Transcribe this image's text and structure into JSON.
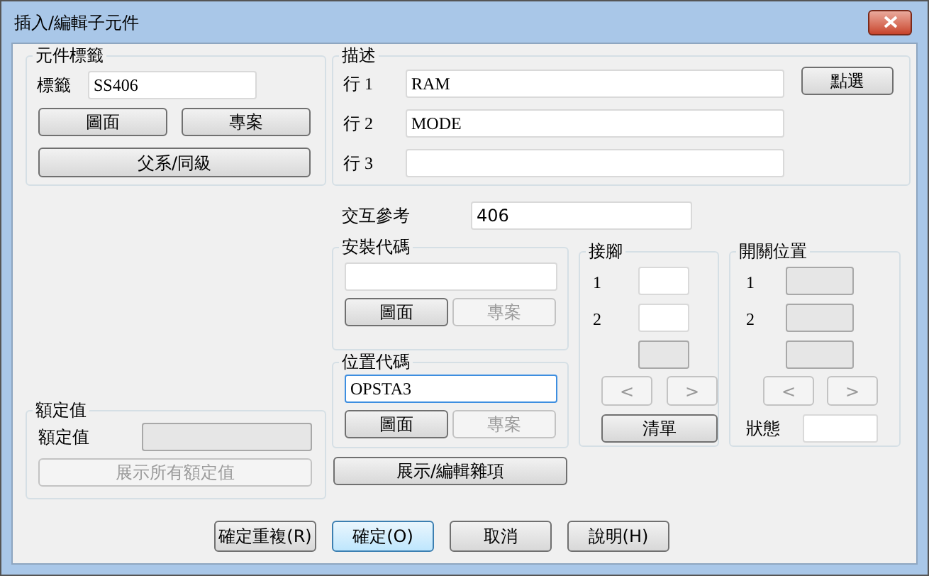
{
  "window": {
    "title": "插入/編輯子元件"
  },
  "component_tag": {
    "title": "元件標籤",
    "label": "標籤",
    "field": {
      "value": "SS406",
      "disabled": false,
      "focused": false
    },
    "buttons": [
      {
        "label": "圖面",
        "disabled": false
      },
      {
        "label": "專案",
        "disabled": false
      }
    ],
    "parent_button": {
      "label": "父系/同級",
      "disabled": false
    }
  },
  "description": {
    "title": "描述",
    "lines": [
      {
        "label": "行 1",
        "value": "RAM"
      },
      {
        "label": "行 2",
        "value": "MODE"
      },
      {
        "label": "行 3"
      }
    ],
    "pick_button": {
      "label": "點選",
      "disabled": false
    }
  },
  "cross_reference": {
    "label": "交互參考",
    "value": "406"
  },
  "install_code": {
    "title": "安裝代碼",
    "field": {
      "disabled": false,
      "focused": false
    },
    "buttons": [
      {
        "label": "圖面",
        "disabled": false
      },
      {
        "label": "專案",
        "disabled": true
      }
    ]
  },
  "location_code": {
    "title": "位置代碼",
    "field": {
      "value": "OPSTA3",
      "disabled": false,
      "focused": true
    },
    "buttons": [
      {
        "label": "圖面",
        "disabled": false
      },
      {
        "label": "專案",
        "disabled": true
      }
    ]
  },
  "misc_button": {
    "label": "展示/編輯雜項",
    "disabled": false
  },
  "pins": {
    "title": "接腳",
    "fields": [
      {
        "label": "1",
        "disabled": false
      },
      {
        "label": "2",
        "disabled": false
      },
      {
        "disabled": true
      }
    ],
    "nav_buttons": [
      {
        "label": "<",
        "disabled": true
      },
      {
        "label": ">",
        "disabled": true
      }
    ],
    "list_button": {
      "label": "清單",
      "disabled": false
    }
  },
  "switch_positions": {
    "title": "開關位置",
    "fields": [
      {
        "label": "1",
        "disabled": true
      },
      {
        "label": "2",
        "disabled": true
      },
      {
        "disabled": true
      }
    ],
    "nav_buttons": [
      {
        "label": "<",
        "disabled": true
      },
      {
        "label": ">",
        "disabled": true
      }
    ],
    "status": {
      "label": "狀態",
      "field": {
        "disabled": false
      }
    }
  },
  "rating": {
    "title": "額定值",
    "label": "額定值",
    "field": {
      "disabled": true
    },
    "show_all_button": {
      "label": "展示所有額定值",
      "disabled": true
    }
  },
  "footer_buttons": [
    {
      "label": "確定重複(R)",
      "default": false
    },
    {
      "label": "確定(O)",
      "default": true
    },
    {
      "label": "取消",
      "default": false
    },
    {
      "label": "說明(H)",
      "default": false
    }
  ]
}
